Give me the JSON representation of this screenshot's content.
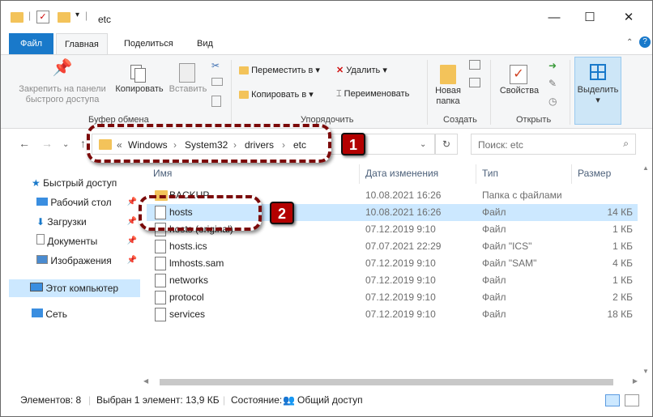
{
  "window": {
    "title": "etc",
    "controls": {
      "minimize": "—",
      "maximize": "☐",
      "close": "✕"
    }
  },
  "ribbon_tabs": {
    "file": "Файл",
    "home": "Главная",
    "share": "Поделиться",
    "view": "Вид"
  },
  "ribbon": {
    "pin_label_1": "Закрепить на панели",
    "pin_label_2": "быстрого доступа",
    "copy": "Копировать",
    "paste": "Вставить",
    "move_to": "Переместить в ▾",
    "copy_to": "Копировать в ▾",
    "delete": "Удалить ▾",
    "rename": "Переименовать",
    "new_folder_1": "Новая",
    "new_folder_2": "папка",
    "properties": "Свойства",
    "select": "Выделить",
    "select_arrow": "▾",
    "groups": {
      "clipboard": "Буфер обмена",
      "organize": "Упорядочить",
      "create": "Создать",
      "open": "Открыть"
    }
  },
  "address": {
    "prefix": "«",
    "crumbs": [
      "Windows",
      "System32",
      "drivers",
      "etc"
    ],
    "separator": "›",
    "search_placeholder": "Поиск: etc"
  },
  "nav": {
    "quick_access": "Быстрый доступ",
    "desktop": "Рабочий стол",
    "downloads": "Загрузки",
    "documents": "Документы",
    "pictures": "Изображения",
    "this_pc": "Этот компьютер",
    "network": "Сеть"
  },
  "columns": {
    "name": "Имя",
    "date": "Дата изменения",
    "type": "Тип",
    "size": "Размер"
  },
  "files": [
    {
      "name": "BACKUP",
      "date": "10.08.2021 16:26",
      "type": "Папка с файлами",
      "size": "",
      "icon": "folder"
    },
    {
      "name": "hosts",
      "date": "10.08.2021 16:26",
      "type": "Файл",
      "size": "14 КБ",
      "icon": "file"
    },
    {
      "name": "hosts (original)",
      "date": "07.12.2019 9:10",
      "type": "Файл",
      "size": "1 КБ",
      "icon": "file"
    },
    {
      "name": "hosts.ics",
      "date": "07.07.2021 22:29",
      "type": "Файл \"ICS\"",
      "size": "1 КБ",
      "icon": "file"
    },
    {
      "name": "lmhosts.sam",
      "date": "07.12.2019 9:10",
      "type": "Файл \"SAM\"",
      "size": "4 КБ",
      "icon": "file"
    },
    {
      "name": "networks",
      "date": "07.12.2019 9:10",
      "type": "Файл",
      "size": "1 КБ",
      "icon": "file"
    },
    {
      "name": "protocol",
      "date": "07.12.2019 9:10",
      "type": "Файл",
      "size": "2 КБ",
      "icon": "file"
    },
    {
      "name": "services",
      "date": "07.12.2019 9:10",
      "type": "Файл",
      "size": "18 КБ",
      "icon": "file"
    }
  ],
  "status": {
    "items": "Элементов: 8",
    "selected": "Выбран 1 элемент: 13,9 КБ",
    "state_label": "Состояние:",
    "state_value": "Общий доступ"
  },
  "annotations": {
    "badge1": "1",
    "badge2": "2",
    "color": "#b30000"
  }
}
